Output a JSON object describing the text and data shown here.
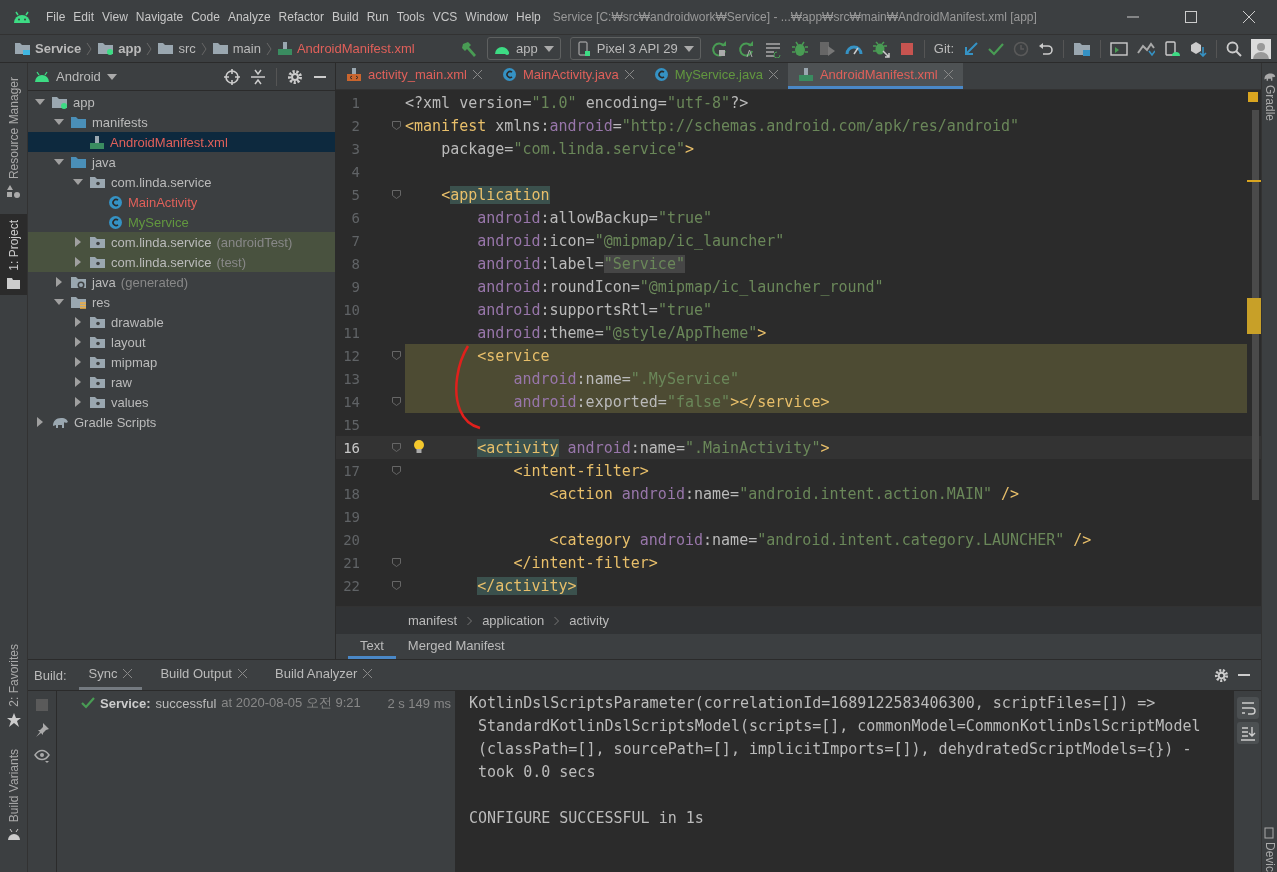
{
  "window": {
    "title": "Service [C:₩src₩androidwork₩Service] - ...₩app₩src₩main₩AndroidManifest.xml [app]"
  },
  "menu": [
    "File",
    "Edit",
    "View",
    "Navigate",
    "Code",
    "Analyze",
    "Refactor",
    "Build",
    "Run",
    "Tools",
    "VCS",
    "Window",
    "Help"
  ],
  "breadcrumb": [
    {
      "label": "Service",
      "kind": "project",
      "color": "#bbbbbb"
    },
    {
      "label": "app",
      "kind": "module",
      "color": "#bbbbbb"
    },
    {
      "label": "src",
      "kind": "folder",
      "color": "#bbbbbb"
    },
    {
      "label": "main",
      "kind": "folder",
      "color": "#bbbbbb"
    },
    {
      "label": "AndroidManifest.xml",
      "kind": "manifest",
      "color": "#e0605a"
    }
  ],
  "toolbar": {
    "run_config": "app",
    "device": "Pixel 3 API 29",
    "git_label": "Git:"
  },
  "left_tool_tabs": [
    {
      "label": "Resource Manager",
      "kind": "resources",
      "selected": false
    },
    {
      "label": "1: Project",
      "kind": "project",
      "selected": true
    },
    {
      "label": "2: Favorites",
      "kind": "favorites",
      "selected": false
    },
    {
      "label": "Build Variants",
      "kind": "variants",
      "selected": false
    }
  ],
  "right_tool_tabs": [
    {
      "label": "Gradle",
      "kind": "gradle"
    },
    {
      "label": "Devic",
      "kind": "device"
    }
  ],
  "project": {
    "view": "Android",
    "tree": [
      {
        "label": "app",
        "kind": "module",
        "color": "#bbbbbb",
        "selected": false,
        "expanded": true,
        "children": [
          {
            "label": "manifests",
            "kind": "folder",
            "color": "#bbbbbb",
            "selected": false,
            "expanded": true,
            "children": [
              {
                "label": "AndroidManifest.xml",
                "kind": "manifest",
                "color": "#e0605a",
                "selected": true
              }
            ]
          },
          {
            "label": "java",
            "kind": "folder",
            "color": "#bbbbbb",
            "selected": false,
            "expanded": true,
            "children": [
              {
                "label": "com.linda.service",
                "kind": "package",
                "color": "#bbbbbb",
                "selected": false,
                "expanded": true,
                "children": [
                  {
                    "label": "MainActivity",
                    "kind": "class",
                    "color": "#e0605a",
                    "selected": false
                  },
                  {
                    "label": "MyService",
                    "kind": "class",
                    "color": "#62973f",
                    "selected": false
                  }
                ]
              },
              {
                "label": "com.linda.service",
                "suffix": "(androidTest)",
                "kind": "test-package",
                "color": "#bbbbbb",
                "selected": false,
                "expanded": false
              },
              {
                "label": "com.linda.service",
                "suffix": "(test)",
                "kind": "test-package",
                "color": "#bbbbbb",
                "selected": false,
                "expanded": false
              }
            ]
          },
          {
            "label": "java",
            "suffix": "(generated)",
            "kind": "generated",
            "color": "#bbbbbb",
            "selected": false,
            "expanded": false
          },
          {
            "label": "res",
            "kind": "res",
            "color": "#bbbbbb",
            "selected": false,
            "expanded": true,
            "children": [
              {
                "label": "drawable",
                "kind": "package",
                "color": "#bbbbbb",
                "selected": false,
                "expanded": false
              },
              {
                "label": "layout",
                "kind": "package",
                "color": "#bbbbbb",
                "selected": false,
                "expanded": false
              },
              {
                "label": "mipmap",
                "kind": "package",
                "color": "#bbbbbb",
                "selected": false,
                "expanded": false
              },
              {
                "label": "raw",
                "kind": "package",
                "color": "#bbbbbb",
                "selected": false,
                "expanded": false
              },
              {
                "label": "values",
                "kind": "package",
                "color": "#bbbbbb",
                "selected": false,
                "expanded": false
              }
            ]
          }
        ]
      },
      {
        "label": "Gradle Scripts",
        "kind": "gradle",
        "color": "#bbbbbb",
        "selected": false,
        "expanded": false
      }
    ]
  },
  "editor": {
    "tabs": [
      {
        "label": "activity_main.xml",
        "kind": "layout",
        "color": "#e0605a",
        "selected": false
      },
      {
        "label": "MainActivity.java",
        "kind": "class",
        "color": "#e0605a",
        "selected": false
      },
      {
        "label": "MyService.java",
        "kind": "class",
        "color": "#62973f",
        "selected": false
      },
      {
        "label": "AndroidManifest.xml",
        "kind": "manifest",
        "color": "#e0605a",
        "selected": true
      }
    ],
    "lines": [
      {
        "n": "1",
        "highlighted": false,
        "current": false,
        "fold": false,
        "bulb": false,
        "tokens": [
          {
            "kind": "text",
            "t": "<?xml version="
          },
          {
            "kind": "val",
            "t": "\"1.0\""
          },
          {
            "kind": "text",
            "t": " encoding="
          },
          {
            "kind": "val",
            "t": "\"utf-8\""
          },
          {
            "kind": "text",
            "t": "?>"
          }
        ]
      },
      {
        "n": "2",
        "highlighted": false,
        "current": false,
        "fold": true,
        "bulb": false,
        "tokens": [
          {
            "kind": "tag",
            "t": "<manifest"
          },
          {
            "kind": "text",
            "t": " xmlns:"
          },
          {
            "kind": "ns",
            "t": "android"
          },
          {
            "kind": "text",
            "t": "="
          },
          {
            "kind": "val",
            "t": "\"http://schemas.android.com/apk/res/android\""
          }
        ]
      },
      {
        "n": "3",
        "highlighted": false,
        "current": false,
        "fold": false,
        "bulb": false,
        "tokens": [
          {
            "kind": "text",
            "t": "    package="
          },
          {
            "kind": "val",
            "t": "\"com.linda.service\""
          },
          {
            "kind": "tag",
            "t": ">"
          }
        ]
      },
      {
        "n": "4",
        "highlighted": false,
        "current": false,
        "fold": false,
        "bulb": false
      },
      {
        "n": "5",
        "highlighted": false,
        "current": false,
        "fold": true,
        "bulb": false,
        "tokens": [
          {
            "kind": "tag",
            "t": "    <"
          },
          {
            "kind": "tagm",
            "t": "application"
          }
        ]
      },
      {
        "n": "6",
        "highlighted": false,
        "current": false,
        "fold": false,
        "bulb": false,
        "tokens": [
          {
            "kind": "ns",
            "t": "        android"
          },
          {
            "kind": "text",
            "t": ":allowBackup="
          },
          {
            "kind": "val",
            "t": "\"true\""
          }
        ]
      },
      {
        "n": "7",
        "highlighted": false,
        "current": false,
        "fold": false,
        "bulb": false,
        "tokens": [
          {
            "kind": "ns",
            "t": "        android"
          },
          {
            "kind": "text",
            "t": ":icon="
          },
          {
            "kind": "val",
            "t": "\"@mipmap/ic_launcher\""
          }
        ]
      },
      {
        "n": "8",
        "highlighted": false,
        "current": false,
        "fold": false,
        "bulb": false,
        "tokens": [
          {
            "kind": "ns",
            "t": "        android"
          },
          {
            "kind": "text",
            "t": ":label="
          },
          {
            "kind": "valbox",
            "t": "\"Service\""
          }
        ]
      },
      {
        "n": "9",
        "highlighted": false,
        "current": false,
        "fold": false,
        "bulb": false,
        "tokens": [
          {
            "kind": "ns",
            "t": "        android"
          },
          {
            "kind": "text",
            "t": ":roundIcon="
          },
          {
            "kind": "val",
            "t": "\"@mipmap/ic_launcher_round\""
          }
        ]
      },
      {
        "n": "10",
        "highlighted": false,
        "current": false,
        "fold": false,
        "bulb": false,
        "tokens": [
          {
            "kind": "ns",
            "t": "        android"
          },
          {
            "kind": "text",
            "t": ":supportsRtl="
          },
          {
            "kind": "val",
            "t": "\"true\""
          }
        ]
      },
      {
        "n": "11",
        "highlighted": false,
        "current": false,
        "fold": false,
        "bulb": false,
        "tokens": [
          {
            "kind": "ns",
            "t": "        android"
          },
          {
            "kind": "text",
            "t": ":theme="
          },
          {
            "kind": "val",
            "t": "\"@style/AppTheme\""
          },
          {
            "kind": "tag",
            "t": ">"
          }
        ]
      },
      {
        "n": "12",
        "highlighted": true,
        "current": false,
        "fold": true,
        "bulb": false,
        "tokens": [
          {
            "kind": "tag",
            "t": "        <service"
          }
        ]
      },
      {
        "n": "13",
        "highlighted": true,
        "current": false,
        "fold": false,
        "bulb": false,
        "tokens": [
          {
            "kind": "ns",
            "t": "            android"
          },
          {
            "kind": "text",
            "t": ":name="
          },
          {
            "kind": "val",
            "t": "\".MyService\""
          }
        ]
      },
      {
        "n": "14",
        "highlighted": true,
        "current": false,
        "fold": true,
        "bulb": false,
        "tokens": [
          {
            "kind": "ns",
            "t": "            android"
          },
          {
            "kind": "text",
            "t": ":exported="
          },
          {
            "kind": "val",
            "t": "\"false\""
          },
          {
            "kind": "tag",
            "t": "></service>"
          }
        ]
      },
      {
        "n": "15",
        "highlighted": false,
        "current": false,
        "fold": false,
        "bulb": false
      },
      {
        "n": "16",
        "highlighted": false,
        "current": true,
        "fold": true,
        "bulb": true,
        "tokens": [
          {
            "kind": "tagm",
            "t": "        <activity"
          },
          {
            "kind": "ns",
            "t": " android"
          },
          {
            "kind": "text",
            "t": ":name="
          },
          {
            "kind": "val",
            "t": "\".MainActivity\""
          },
          {
            "kind": "tag",
            "t": ">"
          }
        ]
      },
      {
        "n": "17",
        "highlighted": false,
        "current": false,
        "fold": true,
        "bulb": false,
        "tokens": [
          {
            "kind": "tag",
            "t": "            <intent-filter>"
          }
        ]
      },
      {
        "n": "18",
        "highlighted": false,
        "current": false,
        "fold": false,
        "bulb": false,
        "tokens": [
          {
            "kind": "tag",
            "t": "                <action "
          },
          {
            "kind": "ns",
            "t": "android"
          },
          {
            "kind": "text",
            "t": ":name="
          },
          {
            "kind": "val",
            "t": "\"android.intent.action.MAIN\""
          },
          {
            "kind": "tag",
            "t": " />"
          }
        ]
      },
      {
        "n": "19",
        "highlighted": false,
        "current": false,
        "fold": false,
        "bulb": false
      },
      {
        "n": "20",
        "highlighted": false,
        "current": false,
        "fold": false,
        "bulb": false,
        "tokens": [
          {
            "kind": "tag",
            "t": "                <category "
          },
          {
            "kind": "ns",
            "t": "android"
          },
          {
            "kind": "text",
            "t": ":name="
          },
          {
            "kind": "val",
            "t": "\"android.intent.category.LAUNCHER\""
          },
          {
            "kind": "tag",
            "t": " />"
          }
        ]
      },
      {
        "n": "21",
        "highlighted": false,
        "current": false,
        "fold": true,
        "bulb": false,
        "tokens": [
          {
            "kind": "tag",
            "t": "            </intent-filter>"
          }
        ]
      },
      {
        "n": "22",
        "highlighted": false,
        "current": false,
        "fold": true,
        "bulb": false,
        "tokens": [
          {
            "kind": "tagm",
            "t": "        </activity>"
          }
        ]
      }
    ],
    "path": [
      "manifest",
      "application",
      "activity"
    ],
    "bottom_tabs": [
      {
        "label": "Text",
        "selected": true
      },
      {
        "label": "Merged Manifest",
        "selected": false
      }
    ]
  },
  "build": {
    "title": "Build:",
    "tabs": [
      {
        "label": "Sync",
        "selected": true
      },
      {
        "label": "Build Output",
        "selected": false
      },
      {
        "label": "Build Analyzer",
        "selected": false
      }
    ],
    "result": {
      "name": "Service:",
      "status": "successful",
      "time": "at 2020-08-05 오전 9:21",
      "duration": "2 s 149 ms"
    },
    "console": [
      {
        "lines": [
          "KotlinDslScriptsParameter(correlationId=1689122583406300, scriptFiles=[]) =>",
          " StandardKotlinDslScriptsModel(scripts=[], commonModel=CommonKotlinDslScriptModel",
          " (classPath=[], sourcePath=[], implicitImports=[]), dehydratedScriptModels={}) -",
          " took 0.0 secs"
        ]
      },
      {
        "lines": [
          "CONFIGURE SUCCESSFUL in 1s"
        ]
      }
    ]
  }
}
